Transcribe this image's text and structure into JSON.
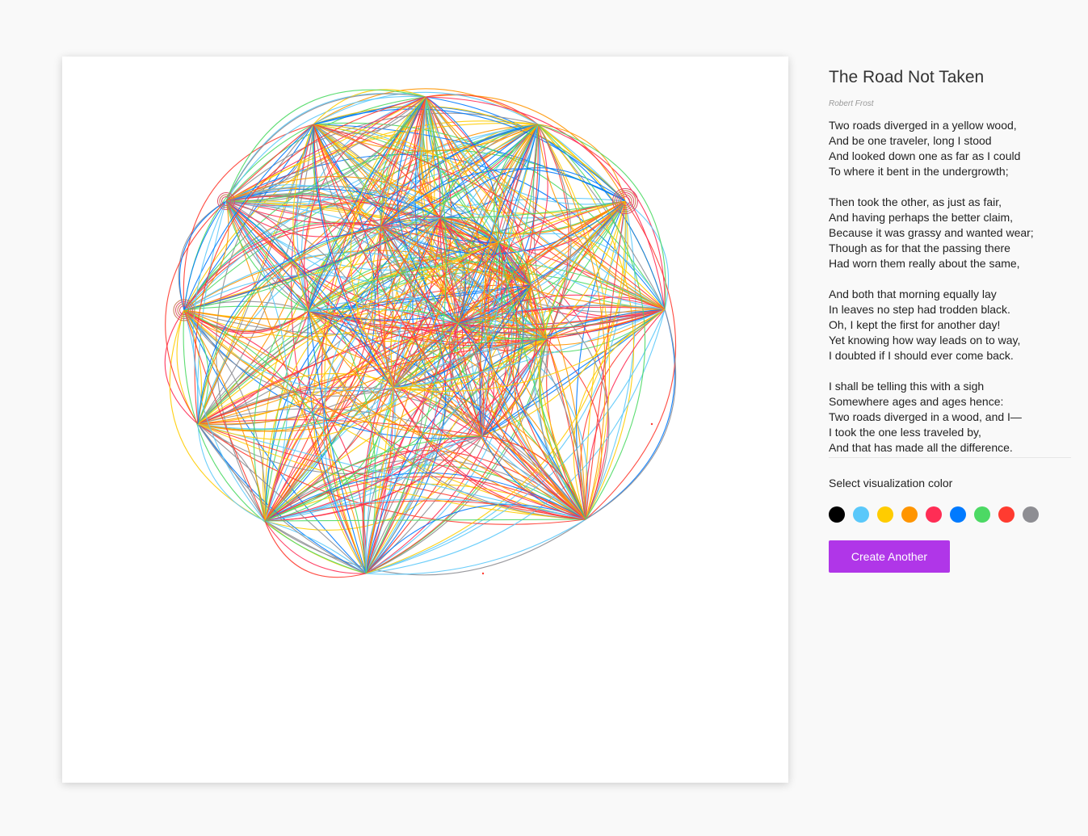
{
  "poem": {
    "title": "The Road Not Taken",
    "author": "Robert Frost",
    "stanzas": [
      [
        "Two roads diverged in a yellow wood,",
        "And be one traveler, long I stood",
        "And looked down one as far as I could",
        "To where it bent in the undergrowth;"
      ],
      [
        "Then took the other, as just as fair,",
        "And having perhaps the better claim,",
        "Because it was grassy and wanted wear;",
        "Though as for that the passing there",
        "Had worn them really about the same,"
      ],
      [
        "And both that morning equally lay",
        "In leaves no step had trodden black.",
        "Oh, I kept the first for another day!",
        "Yet knowing how way leads on to way,",
        "I doubted if I should ever come back."
      ],
      [
        "I shall be telling this with a sigh",
        "Somewhere ages and ages hence:",
        "Two roads diverged in a wood, and I—",
        "I took the one less traveled by,",
        "And that has made all the difference."
      ]
    ]
  },
  "controls": {
    "select_label": "Select visualization color",
    "colors": [
      {
        "name": "black",
        "hex": "#000000"
      },
      {
        "name": "light-blue",
        "hex": "#5ac8fa"
      },
      {
        "name": "yellow",
        "hex": "#ffcc00"
      },
      {
        "name": "orange",
        "hex": "#ff9500"
      },
      {
        "name": "pink",
        "hex": "#ff2d55"
      },
      {
        "name": "blue",
        "hex": "#007aff"
      },
      {
        "name": "green",
        "hex": "#4cd964"
      },
      {
        "name": "red",
        "hex": "#ff3b30"
      },
      {
        "name": "gray",
        "hex": "#8e8e93"
      }
    ],
    "create_label": "Create Another",
    "create_color": "#b036e8"
  }
}
